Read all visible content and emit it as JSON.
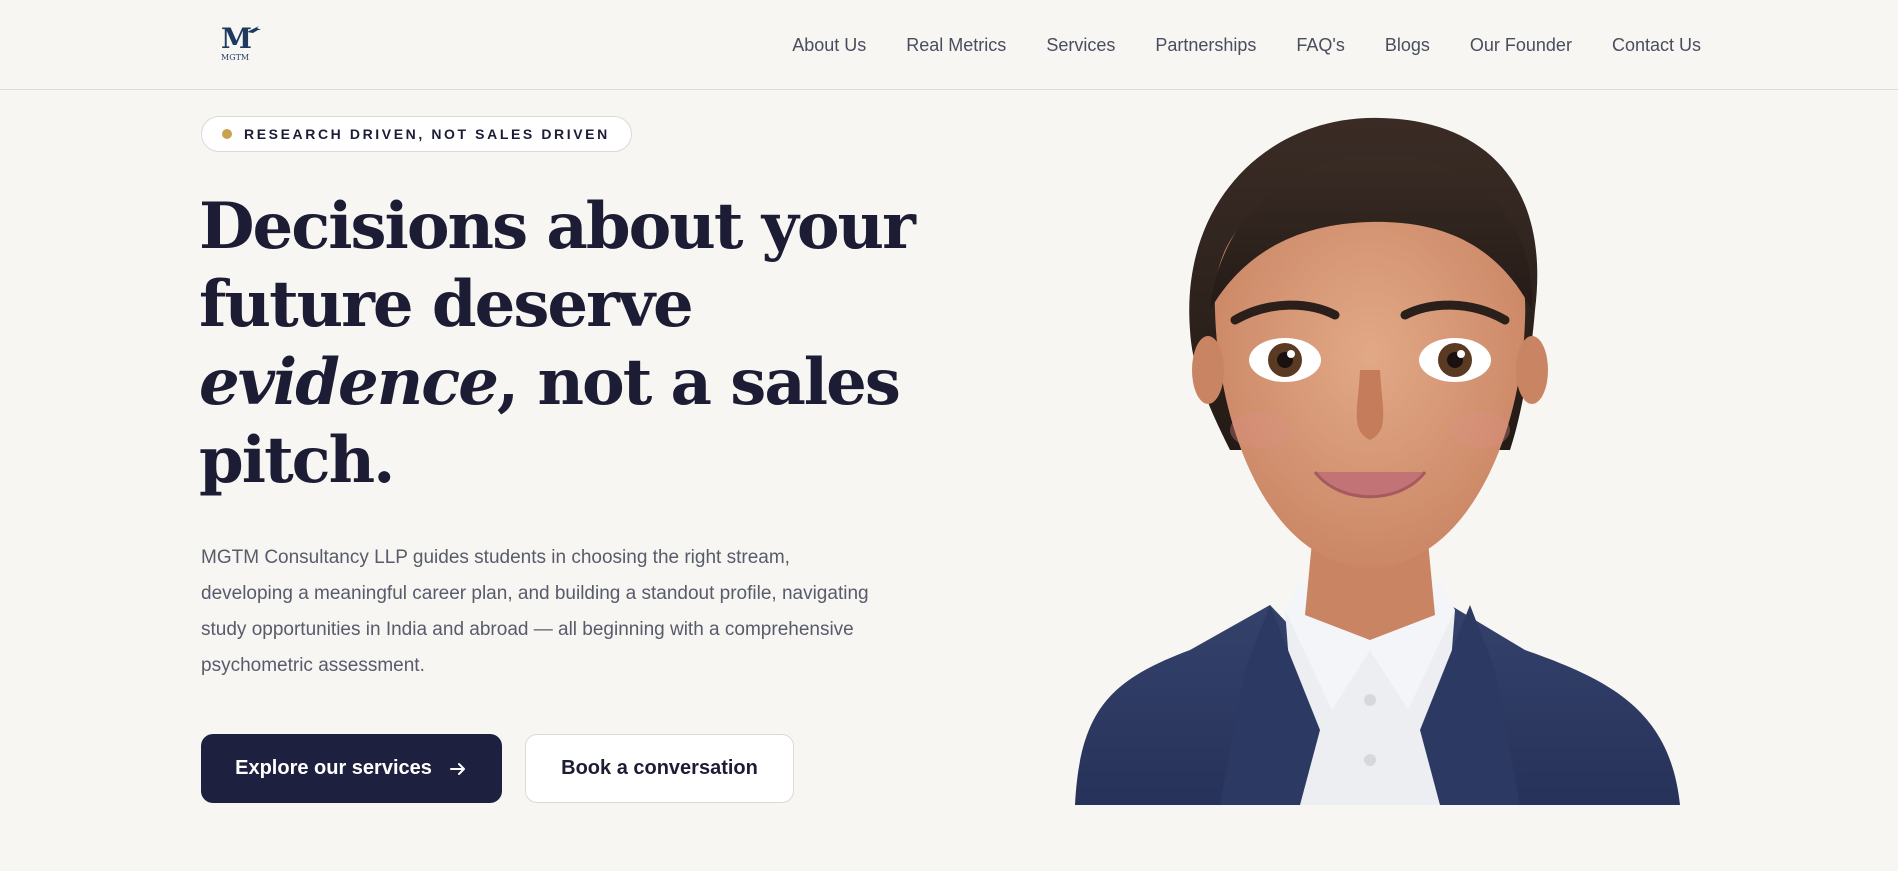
{
  "brand": {
    "logo_text": "MGTM",
    "logo_letter": "M"
  },
  "nav": {
    "items": [
      {
        "label": "About Us"
      },
      {
        "label": "Real Metrics"
      },
      {
        "label": "Services"
      },
      {
        "label": "Partnerships"
      },
      {
        "label": "FAQ's"
      },
      {
        "label": "Blogs"
      },
      {
        "label": "Our Founder"
      },
      {
        "label": "Contact Us"
      }
    ]
  },
  "hero": {
    "badge": "RESEARCH DRIVEN, NOT SALES DRIVEN",
    "headline_part1": "Decisions about your future deserve ",
    "headline_emphasis": "evidence",
    "headline_part2": ", not a sales pitch.",
    "description": "MGTM Consultancy LLP guides students in choosing the right stream, developing a meaningful career plan, and building a standout profile, navigating study opportunities in India and abroad — all beginning with a comprehensive psychometric assessment.",
    "primary_button": "Explore our services",
    "secondary_button": "Book a conversation"
  },
  "icons": {
    "primary_button_icon": "arrow-right-icon",
    "badge_icon": "dot-icon",
    "logo_icon": "airplane-icon"
  },
  "colors": {
    "accent_gold": "#c9a24f",
    "navy": "#1e2040",
    "background": "#f7f6f2"
  }
}
